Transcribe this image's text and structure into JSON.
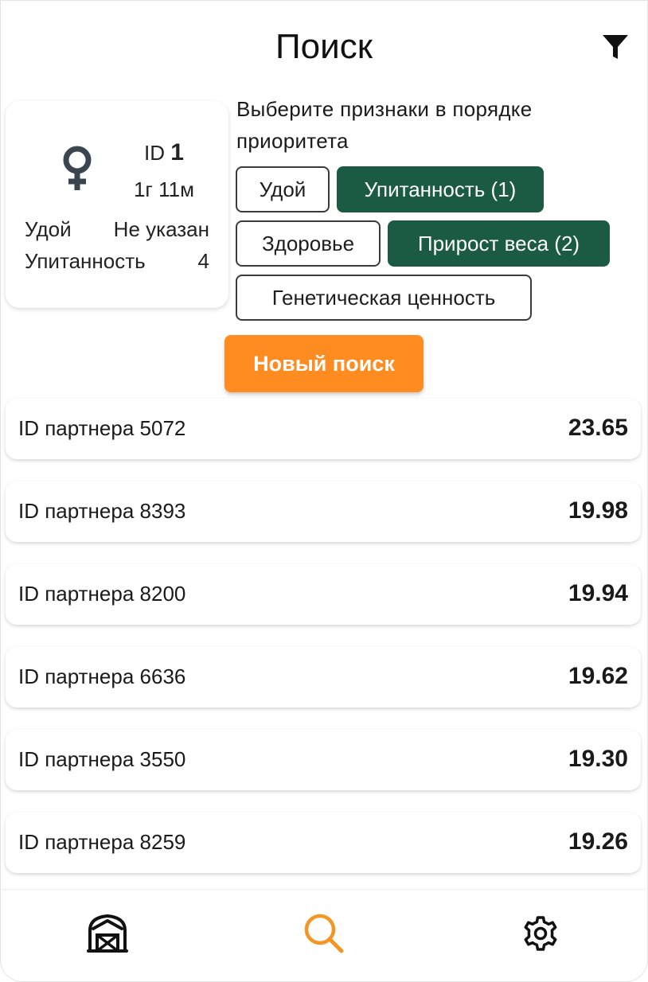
{
  "header": {
    "title": "Поиск"
  },
  "animal": {
    "id_label": "ID",
    "id_value": "1",
    "age": "1г 11м",
    "stats": [
      {
        "label": "Удой",
        "value": "Не указан"
      },
      {
        "label": "Упитанность",
        "value": "4"
      }
    ]
  },
  "traits": {
    "hint": "Выберите признаки в порядке приоритета",
    "items": [
      {
        "label": "Удой",
        "selected": false
      },
      {
        "label": "Упитанность (1)",
        "selected": true
      },
      {
        "label": "Здоровье",
        "selected": false
      },
      {
        "label": "Прирост веса (2)",
        "selected": true
      },
      {
        "label": "Генетическая ценность",
        "selected": false
      }
    ]
  },
  "actions": {
    "new_search": "Новый поиск"
  },
  "results": [
    {
      "label": "ID партнера 5072",
      "score": "23.65"
    },
    {
      "label": "ID партнера 8393",
      "score": "19.98"
    },
    {
      "label": "ID партнера 8200",
      "score": "19.94"
    },
    {
      "label": "ID партнера 6636",
      "score": "19.62"
    },
    {
      "label": "ID партнера 3550",
      "score": "19.30"
    },
    {
      "label": "ID партнера 8259",
      "score": "19.26"
    }
  ],
  "nav": {
    "items": [
      {
        "icon": "barn-icon",
        "active": false
      },
      {
        "icon": "search-icon",
        "active": true
      },
      {
        "icon": "gear-icon",
        "active": false
      }
    ]
  },
  "colors": {
    "selected_chip": "#1b5a43",
    "accent_orange": "#ff8c21",
    "icon_dark": "#3a4550"
  }
}
